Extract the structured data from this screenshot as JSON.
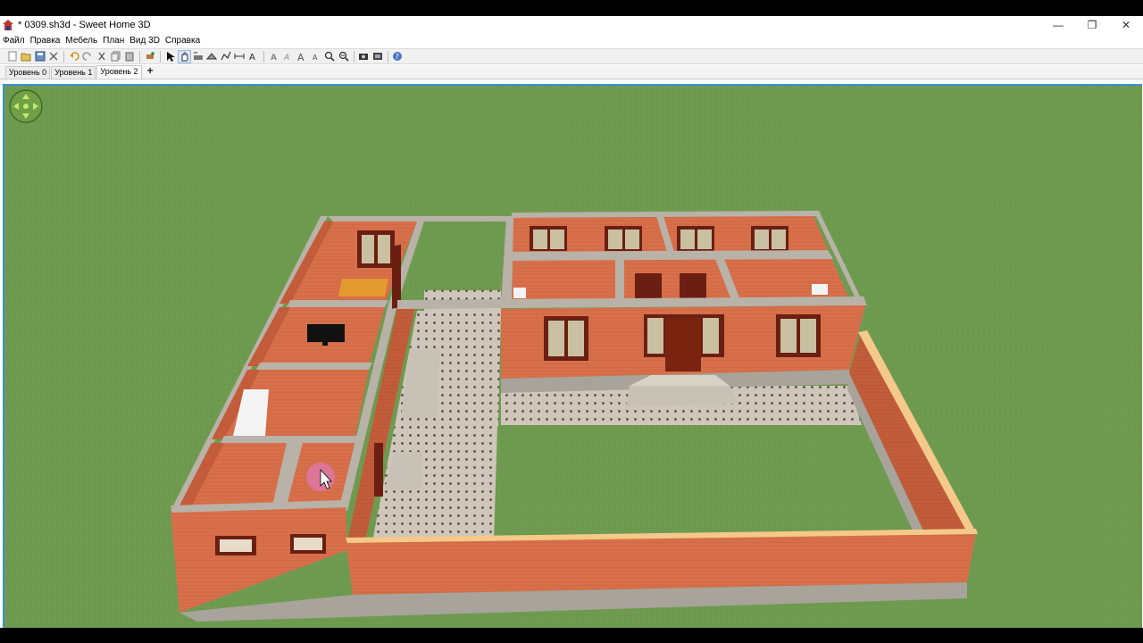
{
  "window": {
    "title": "* 0309.sh3d - Sweet Home 3D",
    "minimize_glyph": "—",
    "restore_glyph": "❐",
    "close_glyph": "✕"
  },
  "menu": [
    "Файл",
    "Правка",
    "Мебель",
    "План",
    "Вид 3D",
    "Справка"
  ],
  "toolbar": {
    "icons": [
      "new-file-icon",
      "open-icon",
      "save-icon",
      "cut-prefs-icon",
      "separator",
      "undo-icon",
      "redo-icon",
      "cut-icon",
      "copy-icon",
      "paste-icon",
      "separator",
      "add-furniture-icon",
      "separator",
      "select-icon",
      "pan-icon",
      "create-walls-icon",
      "create-rooms-icon",
      "create-polylines-icon",
      "create-dimensions-icon",
      "add-text-icon",
      "separator",
      "text-style-bold-icon",
      "text-style-italic-icon",
      "increase-text-icon",
      "decrease-text-icon",
      "zoom-in-icon",
      "zoom-out-icon",
      "separator",
      "create-photo-icon",
      "create-video-icon",
      "separator",
      "help-icon"
    ],
    "active_tool": "pan-icon"
  },
  "levels": {
    "tabs": [
      "Уровень 0",
      "Уровень 1",
      "Уровень 2"
    ],
    "selected": "Уровень 2",
    "add_label": "+"
  },
  "colors": {
    "grass": "#6e9a4f",
    "brick": "#d7704a",
    "wall_top": "#b9b2a8",
    "window_frame": "#6b1f12",
    "paving": "#c9bfb4",
    "accent_border": "#3a8fd6"
  }
}
